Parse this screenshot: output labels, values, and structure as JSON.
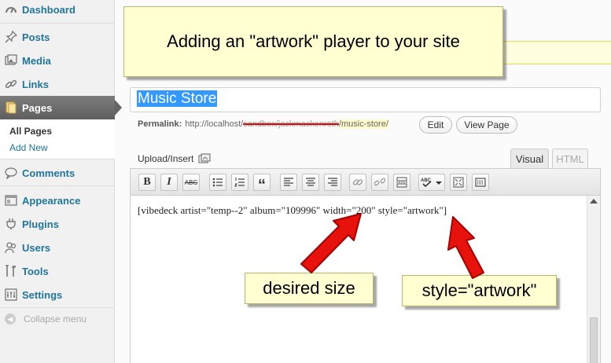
{
  "sidebar": {
    "items": [
      {
        "label": "Dashboard",
        "icon": "dashboard-icon"
      },
      {
        "label": "Posts",
        "icon": "pin-icon"
      },
      {
        "label": "Media",
        "icon": "media-icon"
      },
      {
        "label": "Links",
        "icon": "link-icon"
      },
      {
        "label": "Pages",
        "icon": "pages-icon"
      },
      {
        "label": "Comments",
        "icon": "comment-icon"
      },
      {
        "label": "Appearance",
        "icon": "appearance-icon"
      },
      {
        "label": "Plugins",
        "icon": "plugin-icon"
      },
      {
        "label": "Users",
        "icon": "users-icon"
      },
      {
        "label": "Tools",
        "icon": "tools-icon"
      },
      {
        "label": "Settings",
        "icon": "settings-icon"
      }
    ],
    "submenu": [
      "All Pages",
      "Add New"
    ],
    "collapse_label": "Collapse menu"
  },
  "callouts": {
    "title": "Adding an \"artwork\" player to your site",
    "size": "desired size",
    "style": "style=\"artwork\""
  },
  "editor": {
    "title_value": "Music Store",
    "permalink_label": "Permalink:",
    "permalink_base": "http://localhost/",
    "permalink_struck": "sandbox/jackmackenroth",
    "permalink_slug": "/music-store/",
    "edit_button": "Edit",
    "view_button": "View Page",
    "upload_insert": "Upload/Insert",
    "tab_visual": "Visual",
    "tab_html": "HTML",
    "content": "[vibedeck artist=\"temp--2\" album=\"109996\" width=\"200\" style=\"artwork\"]"
  },
  "toolbar": {
    "bold": "B",
    "italic": "I",
    "strike": "ABC",
    "quote": "“"
  },
  "colors": {
    "link": "#21759b",
    "callout_bg": "#ffffd1",
    "arrow": "#e8120c",
    "selection": "#3399ff"
  }
}
